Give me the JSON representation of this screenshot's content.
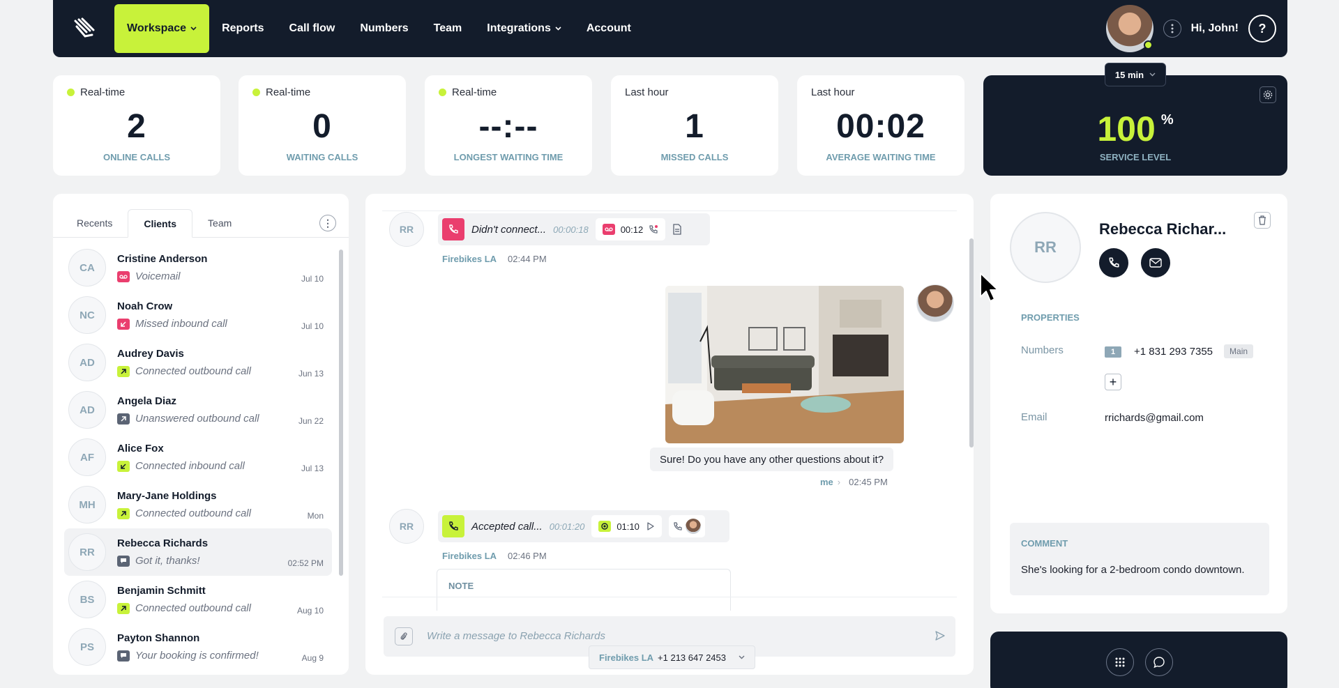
{
  "nav": {
    "items": [
      {
        "label": "Workspace",
        "active": true,
        "dropdown": true
      },
      {
        "label": "Reports"
      },
      {
        "label": "Call flow"
      },
      {
        "label": "Numbers"
      },
      {
        "label": "Team"
      },
      {
        "label": "Integrations",
        "dropdown": true
      },
      {
        "label": "Account"
      }
    ],
    "greeting": "Hi, John!",
    "help_symbol": "?"
  },
  "stats": [
    {
      "label": "Real-time",
      "value": "2",
      "caption": "ONLINE CALLS",
      "live": true
    },
    {
      "label": "Real-time",
      "value": "0",
      "caption": "WAITING CALLS",
      "live": true
    },
    {
      "label": "Real-time",
      "value": "--:--",
      "caption": "LONGEST WAITING TIME",
      "live": true
    },
    {
      "label": "Last hour",
      "value": "1",
      "caption": "MISSED CALLS",
      "live": false
    },
    {
      "label": "Last hour",
      "value": "00:02",
      "caption": "AVERAGE WAITING TIME",
      "live": false
    }
  ],
  "service_level": {
    "value": "100",
    "unit": "%",
    "caption": "SERVICE LEVEL",
    "interval": "15 min"
  },
  "left_panel": {
    "tabs": [
      {
        "label": "Recents"
      },
      {
        "label": "Clients",
        "active": true
      },
      {
        "label": "Team"
      }
    ],
    "contacts": [
      {
        "initials": "CA",
        "name": "Cristine Anderson",
        "status": "Voicemail",
        "icon": "voicemail-icon",
        "color": "#ea3e6e",
        "date": "Jul 10"
      },
      {
        "initials": "NC",
        "name": "Noah Crow",
        "status": "Missed inbound call",
        "icon": "missed-inbound-icon",
        "color": "#ea3e6e",
        "date": "Jul 10"
      },
      {
        "initials": "AD",
        "name": "Audrey Davis",
        "status": "Connected outbound call",
        "icon": "outbound-arrow-icon",
        "color": "#c8f23a",
        "date": "Jun 13"
      },
      {
        "initials": "AD",
        "name": "Angela Diaz",
        "status": "Unanswered outbound call",
        "icon": "outbound-arrow-icon",
        "color": "#5b6474",
        "date": "Jun 22"
      },
      {
        "initials": "AF",
        "name": "Alice Fox",
        "status": "Connected inbound call",
        "icon": "inbound-arrow-icon",
        "color": "#c8f23a",
        "date": "Jul 13"
      },
      {
        "initials": "MH",
        "name": "Mary-Jane Holdings",
        "status": "Connected outbound call",
        "icon": "outbound-arrow-icon",
        "color": "#c8f23a",
        "date": "Mon"
      },
      {
        "initials": "RR",
        "name": "Rebecca Richards",
        "status": "Got it, thanks!",
        "icon": "message-icon",
        "color": "#5b6474",
        "date": "02:52 PM",
        "selected": true
      },
      {
        "initials": "BS",
        "name": "Benjamin Schmitt",
        "status": "Connected outbound call",
        "icon": "outbound-arrow-icon",
        "color": "#c8f23a",
        "date": "Aug 10"
      },
      {
        "initials": "PS",
        "name": "Payton Shannon",
        "status": "Your booking is confirmed!",
        "icon": "message-icon",
        "color": "#5b6474",
        "date": "Aug 9"
      }
    ]
  },
  "chat": {
    "call1": {
      "initials": "RR",
      "text": "Didn't connect...",
      "duration": "00:00:18",
      "voicemail_time": "00:12",
      "line": "Firebikes LA",
      "time": "02:44 PM"
    },
    "message": {
      "text": "Sure! Do you have any other questions about it?",
      "sender": "me",
      "time": "02:45 PM"
    },
    "call2": {
      "initials": "RR",
      "text": "Accepted call...",
      "duration": "00:01:20",
      "recording_time": "01:10",
      "line": "Firebikes LA",
      "time": "02:46 PM"
    },
    "note_label": "NOTE",
    "composer_placeholder": "Write a message to Rebecca Richards",
    "from_line": "Firebikes LA",
    "from_number": "+1 213 647 2453"
  },
  "contact": {
    "initials": "RR",
    "name": "Rebecca Richar...",
    "properties_label": "PROPERTIES",
    "numbers_label": "Numbers",
    "number_index": "1",
    "number": "+1 831 293 7355",
    "number_tag": "Main",
    "add_symbol": "+",
    "email_label": "Email",
    "email": "rrichards@gmail.com",
    "comment_label": "COMMENT",
    "comment": "She's looking for a 2-bedroom condo downtown."
  }
}
